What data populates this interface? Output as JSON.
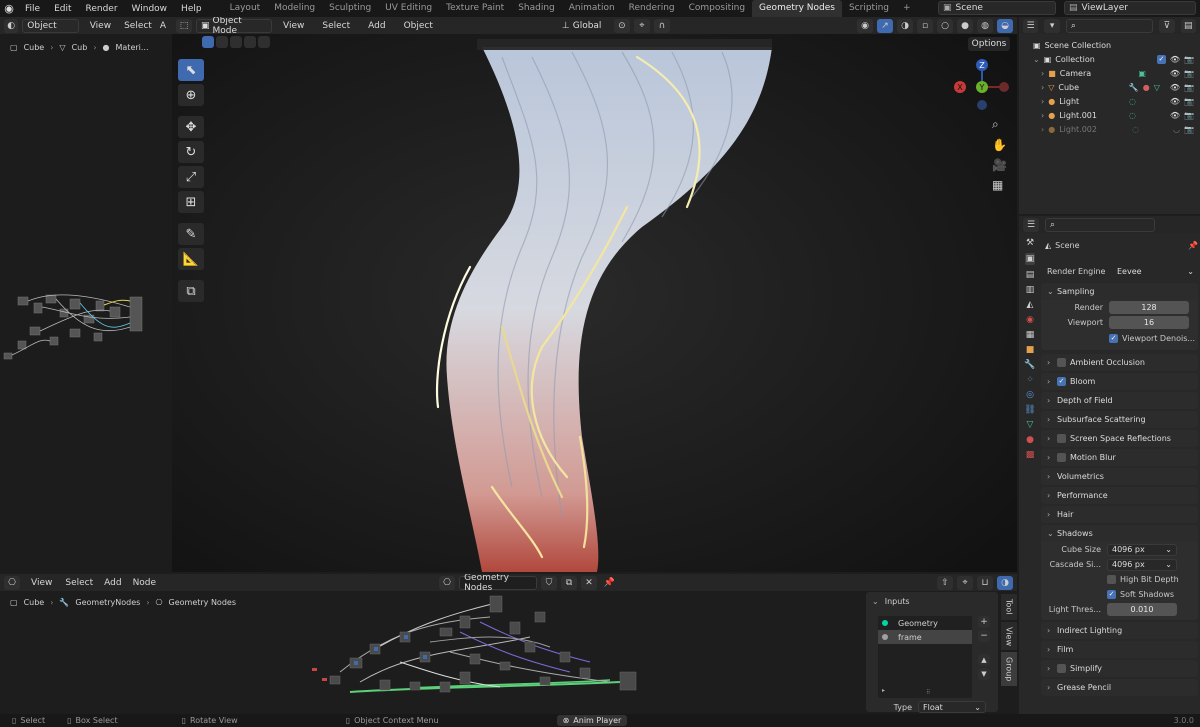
{
  "top_menu": {
    "items": [
      "File",
      "Edit",
      "Render",
      "Window",
      "Help"
    ]
  },
  "workspace_tabs": {
    "items": [
      "Layout",
      "Modeling",
      "Sculpting",
      "UV Editing",
      "Texture Paint",
      "Shading",
      "Animation",
      "Rendering",
      "Compositing",
      "Geometry Nodes",
      "Scripting"
    ],
    "active": "Geometry Nodes",
    "add": "+"
  },
  "scene_field": "Scene",
  "viewlayer_field": "ViewLayer",
  "left_header": {
    "mode": "Object",
    "menus": [
      "View",
      "Select",
      "A"
    ]
  },
  "left_breadcrumb": {
    "items": [
      "Cube",
      "Cub",
      "Materi..."
    ]
  },
  "viewport": {
    "mode": "Object Mode",
    "menus": [
      "View",
      "Select",
      "Add",
      "Object"
    ],
    "orientation": "Global",
    "options_label": "Options",
    "gizmo": {
      "z": "Z",
      "y": "Y",
      "x": "X"
    }
  },
  "outliner": {
    "root": "Scene Collection",
    "collection": "Collection",
    "rows": [
      {
        "label": "Camera",
        "dim": false
      },
      {
        "label": "Cube",
        "dim": false
      },
      {
        "label": "Light",
        "dim": false
      },
      {
        "label": "Light.001",
        "dim": false
      },
      {
        "label": "Light.002",
        "dim": true
      }
    ]
  },
  "properties": {
    "title": "Scene",
    "render_engine_label": "Render Engine",
    "render_engine_value": "Eevee",
    "sampling": {
      "label": "Sampling",
      "render_label": "Render",
      "render_value": "128",
      "viewport_label": "Viewport",
      "viewport_value": "16",
      "denoise_label": "Viewport Denois..."
    },
    "sections": [
      {
        "label": "Ambient Occlusion",
        "checkbox": "off"
      },
      {
        "label": "Bloom",
        "checkbox": "on"
      },
      {
        "label": "Depth of Field",
        "checkbox": "none"
      },
      {
        "label": "Subsurface Scattering",
        "checkbox": "none"
      },
      {
        "label": "Screen Space Reflections",
        "checkbox": "off"
      },
      {
        "label": "Motion Blur",
        "checkbox": "off"
      },
      {
        "label": "Volumetrics",
        "checkbox": "none"
      },
      {
        "label": "Performance",
        "checkbox": "none"
      },
      {
        "label": "Hair",
        "checkbox": "none"
      }
    ],
    "shadows": {
      "label": "Shadows",
      "cube_size_label": "Cube Size",
      "cube_size_value": "4096 px",
      "cascade_label": "Cascade Si...",
      "cascade_value": "4096 px",
      "high_bit_label": "High Bit Depth",
      "soft_label": "Soft Shadows",
      "light_thres_label": "Light Thres...",
      "light_thres_value": "0.010"
    },
    "sections2": [
      {
        "label": "Indirect Lighting",
        "checkbox": "none"
      },
      {
        "label": "Film",
        "checkbox": "none"
      },
      {
        "label": "Simplify",
        "checkbox": "off"
      },
      {
        "label": "Grease Pencil",
        "checkbox": "none"
      }
    ]
  },
  "node_editor": {
    "menus": [
      "View",
      "Select",
      "Add",
      "Node"
    ],
    "tree_name": "Geometry Nodes",
    "breadcrumb": [
      "Cube",
      "GeometryNodes",
      "Geometry Nodes"
    ],
    "inputs_panel": {
      "title": "Inputs",
      "items": [
        "Geometry",
        "frame"
      ],
      "type_label": "Type",
      "type_value": "Float"
    },
    "side_tabs": [
      "Tool",
      "View",
      "Group"
    ]
  },
  "status_bar": {
    "items": [
      "Select",
      "Box Select",
      "Rotate View",
      "Object Context Menu",
      "Anim Player"
    ],
    "version": "3.0.0"
  },
  "colors": {
    "accent": "#4772b3",
    "geometry_socket": "#00d6a3",
    "float_socket": "#a1a1a1"
  }
}
